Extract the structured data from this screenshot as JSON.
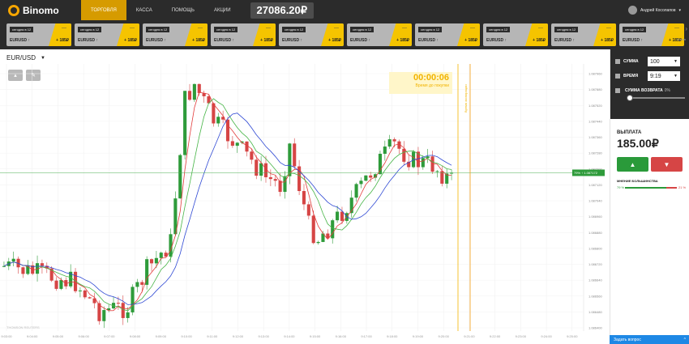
{
  "header": {
    "logo": "Binomo",
    "nav": [
      "ТОРГОВЛЯ",
      "КАССА",
      "ПОМОЩЬ",
      "АКЦИИ"
    ],
    "balance": "27086.20₽",
    "user": "Андрей Косолапов"
  },
  "asset_cards": {
    "tag": "сегодня в 12",
    "pair": "EURUSD ↑",
    "payout": "+ 185₽",
    "dash": "—",
    "count": 10
  },
  "assetbar": {
    "more": "›",
    "sub": "Архив"
  },
  "chart": {
    "pair": "EUR/USD",
    "timer": "00:00:06",
    "timer_label": "Время до покупки",
    "expiry_label": "Время экспирации",
    "current_price_tag": "79% ↑ 1.087172",
    "source": "THOMSON REUTERS",
    "price_ticks": [
      "1.087960",
      "1.087880",
      "1.087520",
      "1.087440",
      "1.087360",
      "1.087280",
      "1.087200",
      "1.087120",
      "1.087040",
      "1.086960",
      "1.086880",
      "1.086800",
      "1.086720",
      "1.086640",
      "1.086560",
      "1.086480",
      "1.086400"
    ],
    "time_ticks": [
      "9:03:00",
      "9:04:00",
      "9:05:00",
      "9:06:00",
      "9:07:00",
      "9:08:00",
      "9:09:00",
      "9:10:00",
      "9:11:00",
      "9:12:00",
      "9:13:00",
      "9:14:00",
      "9:15:00",
      "9:16:00",
      "9:17:00",
      "9:18:00",
      "9:19:00",
      "9:20:00",
      "9:21:00",
      "9:22:00",
      "9:23:00",
      "9:24:00",
      "9:25:00"
    ],
    "colors": {
      "bull": "#2e9b3a",
      "bear": "#d64545",
      "ma_fast": "#e23b3b",
      "ma_mid": "#47b547",
      "ma_slow": "#2f49d4",
      "gold": "#f2b400"
    }
  },
  "side": {
    "amount_label": "СУММА",
    "amount_value": "100",
    "time_label": "ВРЕМЯ",
    "time_value": "9:19",
    "return_label": "СУММА ВОЗВРАТА",
    "return_pct": "0%",
    "payout_label": "ВЫПЛАТА",
    "payout_value": "185.00₽",
    "majority_label": "МНЕНИЕ БОЛЬШИНСТВА",
    "majority_up": "79 %",
    "majority_down": "21 %",
    "majority_fraction": 0.79
  },
  "ask": {
    "label": "Задать вопрос",
    "arrow": "^"
  }
}
